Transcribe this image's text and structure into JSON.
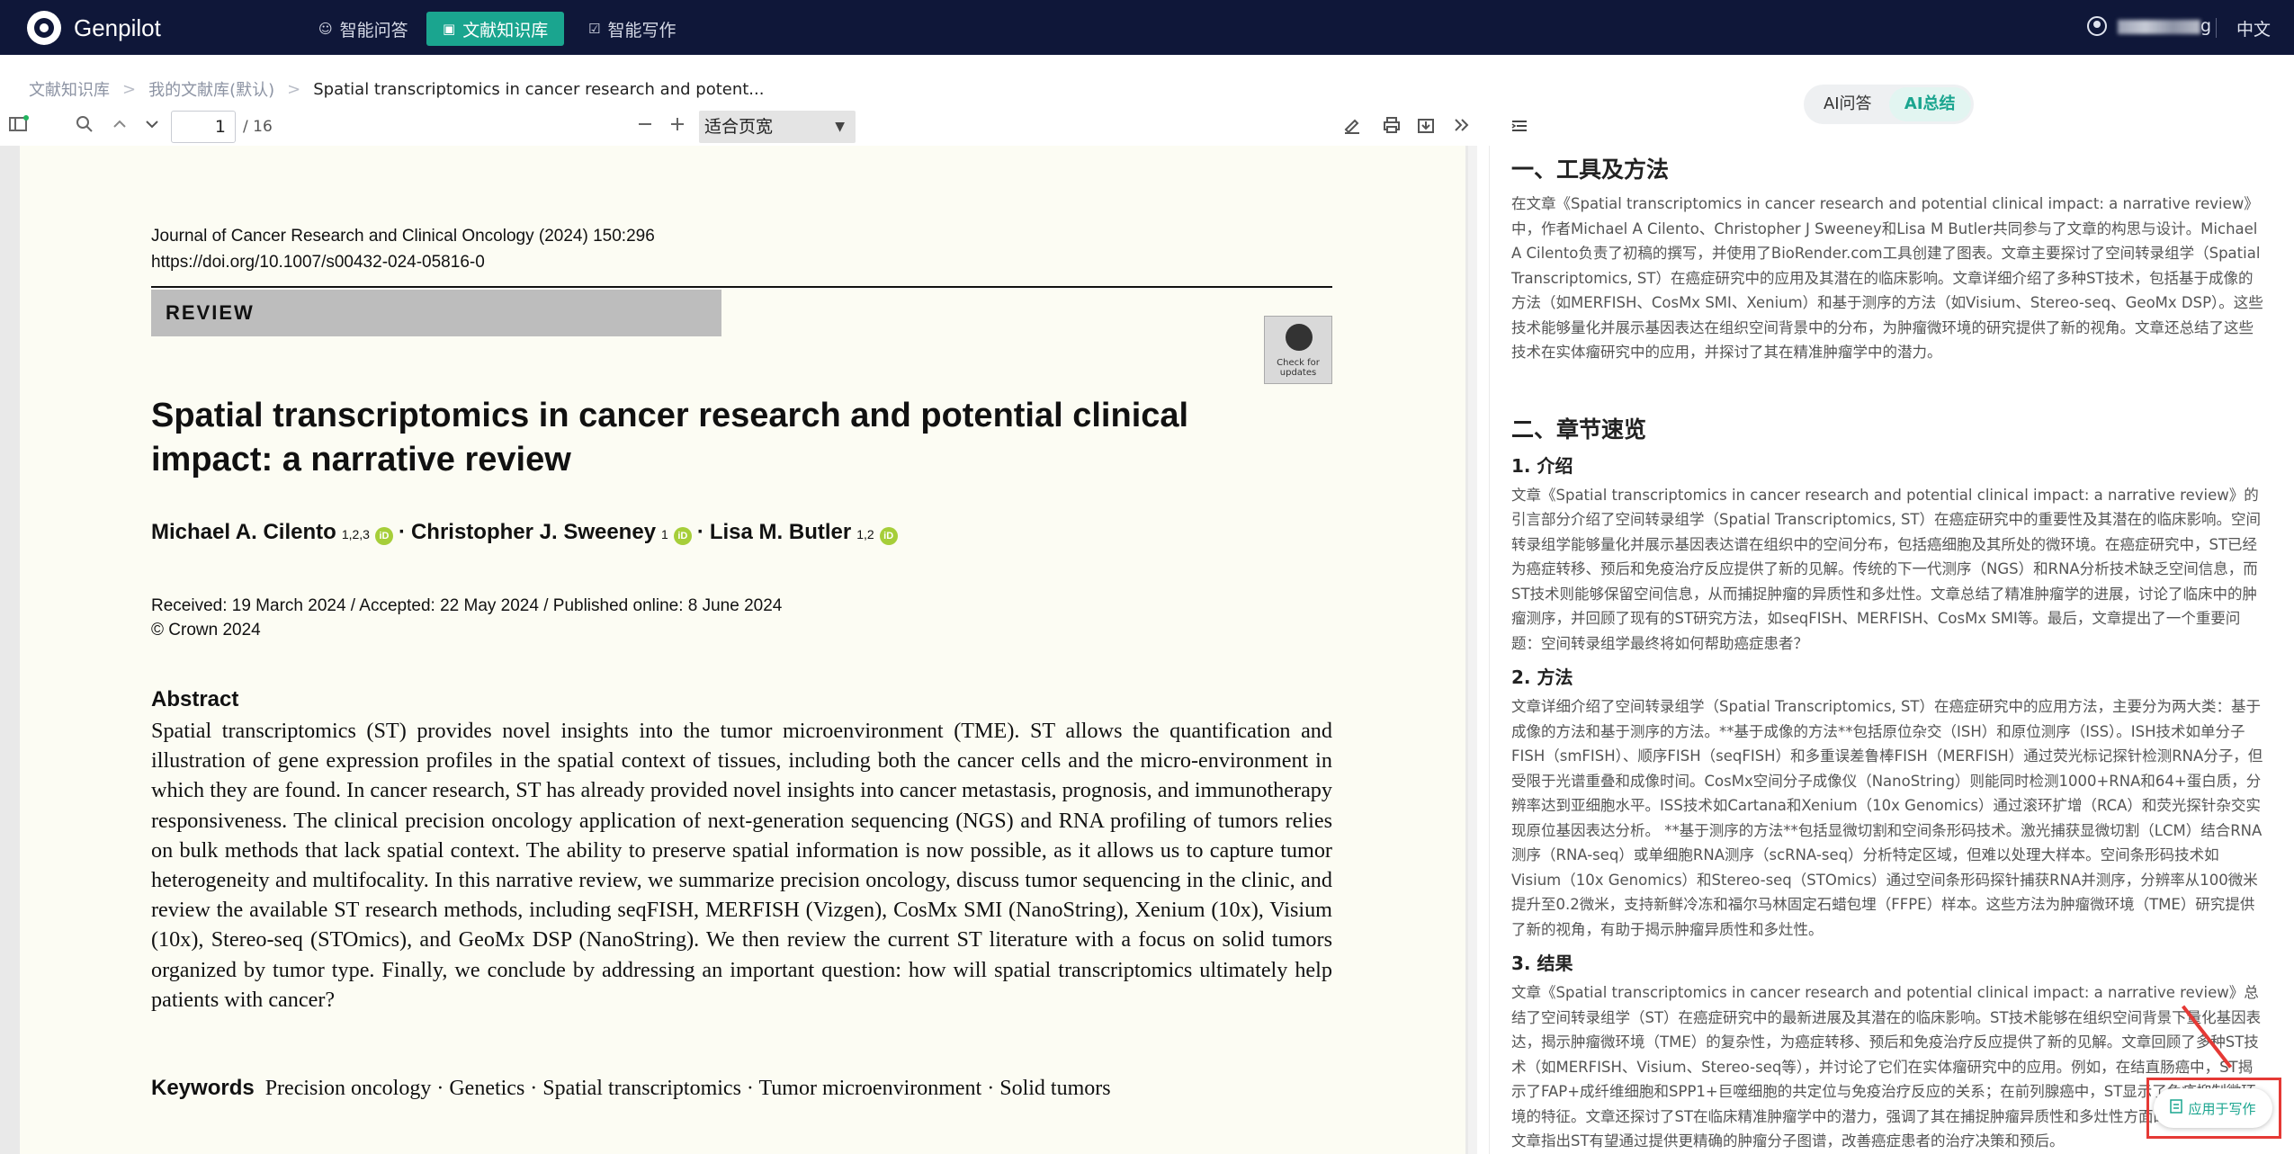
{
  "nav": {
    "brand": "Genpilot",
    "tabs": [
      {
        "icon": "☺",
        "label": "智能问答"
      },
      {
        "icon": "▣",
        "label": "文献知识库"
      },
      {
        "icon": "☑",
        "label": "智能写作"
      }
    ],
    "user_suffix": "g",
    "lang": "中文"
  },
  "breadcrumb": {
    "items": [
      "文献知识库",
      "我的文献库(默认)",
      "Spatial transcriptomics in cancer research and potent..."
    ],
    "sep": ">"
  },
  "viewer": {
    "page_current": "1",
    "page_total": "/ 16",
    "zoom": "适合页宽"
  },
  "pdf": {
    "journal": "Journal of Cancer Research and Clinical Oncology (2024) 150:296",
    "doi": "https://doi.org/10.1007/s00432-024-05816-0",
    "section": "REVIEW",
    "check_updates": "Check for updates",
    "title": "Spatial transcriptomics in cancer research and potential clinical impact: a narrative review",
    "authors": [
      {
        "name": "Michael A. Cilento",
        "sup": "1,2,3"
      },
      {
        "name": "Christopher J. Sweeney",
        "sup": "1"
      },
      {
        "name": "Lisa M. Butler",
        "sup": "1,2"
      }
    ],
    "author_sep": "·",
    "received": "Received: 19 March 2024 / Accepted: 22 May 2024 / Published online: 8 June 2024",
    "copyright": "© Crown 2024",
    "abstract_heading": "Abstract",
    "abstract": "Spatial transcriptomics (ST) provides novel insights into the tumor microenvironment (TME). ST allows the quantification and illustration of gene expression profiles in the spatial context of tissues, including both the cancer cells and the micro-environment in which they are found. In cancer research, ST has already provided novel insights into cancer metastasis, prognosis, and immunotherapy responsiveness. The clinical precision oncology application of next-generation sequencing (NGS) and RNA profiling of tumors relies on bulk methods that lack spatial context. The ability to preserve spatial information is now possible, as it allows us to capture tumor heterogeneity and multifocality. In this narrative review, we summarize precision oncology, discuss tumor sequencing in the clinic, and review the available ST research methods, including seqFISH, MERFISH (Vizgen), CosMx SMI (NanoString), Xenium (10x), Visium (10x), Stereo-seq (STOmics), and GeoMx DSP (NanoString). We then review the current ST literature with a focus on solid tumors organized by tumor type. Finally, we conclude by addressing an important question: how will spatial transcriptomics ultimately help patients with cancer?",
    "keywords_heading": "Keywords",
    "keywords": "Precision oncology · Genetics · Spatial transcriptomics · Tumor microenvironment · Solid tumors"
  },
  "ai": {
    "tabs": [
      "AI问答",
      "AI总结"
    ],
    "h_tools": "一、工具及方法",
    "p_tools": "在文章《Spatial transcriptomics in cancer research and potential clinical impact: a narrative review》中，作者Michael A Cilento、Christopher J Sweeney和Lisa M Butler共同参与了文章的构思与设计。Michael A Cilento负责了初稿的撰写，并使用了BioRender.com工具创建了图表。文章主要探讨了空间转录组学（Spatial Transcriptomics, ST）在癌症研究中的应用及其潜在的临床影响。文章详细介绍了多种ST技术，包括基于成像的方法（如MERFISH、CosMx SMI、Xenium）和基于测序的方法（如Visium、Stereo-seq、GeoMx DSP）。这些技术能够量化并展示基因表达在组织空间背景中的分布，为肿瘤微环境的研究提供了新的视角。文章还总结了这些技术在实体瘤研究中的应用，并探讨了其在精准肿瘤学中的潜力。",
    "h_chapters": "二、章节速览",
    "s1": "1. 介绍",
    "p1": "文章《Spatial transcriptomics in cancer research and potential clinical impact: a narrative review》的引言部分介绍了空间转录组学（Spatial Transcriptomics, ST）在癌症研究中的重要性及其潜在的临床影响。空间转录组学能够量化并展示基因表达谱在组织中的空间分布，包括癌细胞及其所处的微环境。在癌症研究中，ST已经为癌症转移、预后和免疫治疗反应提供了新的见解。传统的下一代测序（NGS）和RNA分析技术缺乏空间信息，而ST技术则能够保留空间信息，从而捕捉肿瘤的异质性和多灶性。文章总结了精准肿瘤学的进展，讨论了临床中的肿瘤测序，并回顾了现有的ST研究方法，如seqFISH、MERFISH、CosMx SMI等。最后，文章提出了一个重要问题：空间转录组学最终将如何帮助癌症患者？",
    "s2": "2. 方法",
    "p2": "文章详细介绍了空间转录组学（Spatial Transcriptomics, ST）在癌症研究中的应用方法，主要分为两大类：基于成像的方法和基于测序的方法。**基于成像的方法**包括原位杂交（ISH）和原位测序（ISS）。ISH技术如单分子FISH（smFISH）、顺序FISH（seqFISH）和多重误差鲁棒FISH（MERFISH）通过荧光标记探针检测RNA分子，但受限于光谱重叠和成像时间。CosMx空间分子成像仪（NanoString）则能同时检测1000+RNA和64+蛋白质，分辨率达到亚细胞水平。ISS技术如Cartana和Xenium（10x Genomics）通过滚环扩增（RCA）和荧光探针杂交实现原位基因表达分析。 **基于测序的方法**包括显微切割和空间条形码技术。激光捕获显微切割（LCM）结合RNA测序（RNA-seq）或单细胞RNA测序（scRNA-seq）分析特定区域，但难以处理大样本。空间条形码技术如Visium（10x Genomics）和Stereo-seq（STOmics）通过空间条形码探针捕获RNA并测序，分辨率从100微米提升至0.2微米，支持新鲜冷冻和福尔马林固定石蜡包埋（FFPE）样本。这些方法为肿瘤微环境（TME）研究提供了新的视角，有助于揭示肿瘤异质性和多灶性。",
    "s3": "3. 结果",
    "p3": "文章《Spatial transcriptomics in cancer research and potential clinical impact: a narrative review》总结了空间转录组学（ST）在癌症研究中的最新进展及其潜在的临床影响。ST技术能够在组织空间背景下量化基因表达，揭示肿瘤微环境（TME）的复杂性，为癌症转移、预后和免疫治疗反应提供了新的见解。文章回顾了多种ST技术（如MERFISH、Visium、Stereo-seq等），并讨论了它们在实体瘤研究中的应用。例如，在结直肠癌中，ST揭示了FAP+成纤维细胞和SPP1+巨噬细胞的共定位与免疫治疗反应的关系；在前列腺癌中，ST显示了免疫抑制微环境的特征。文章还探讨了ST在临床精准肿瘤学中的潜力，强调了其在捕捉肿瘤异质性和多灶性方面的优势。最终，文章指出ST有望通过提供更精确的肿瘤分子图谱，改善癌症患者的治疗决策和预后。",
    "apply_button": "应用于写作"
  }
}
